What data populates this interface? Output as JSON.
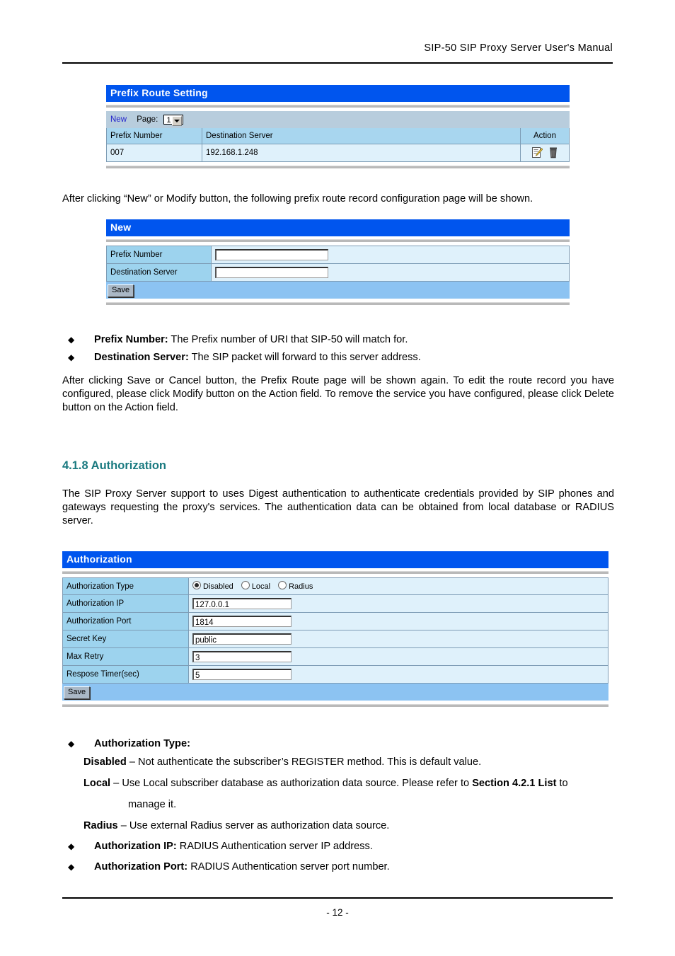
{
  "document": {
    "header_title": "SIP-50 SIP Proxy Server User's Manual",
    "footer_page": "- 12 -"
  },
  "prefix_route_panel": {
    "title": "Prefix Route Setting",
    "toolbar": {
      "new_link": "New",
      "page_label": "Page:",
      "page_value": "1"
    },
    "columns": [
      "Prefix Number",
      "Destination Server",
      "Action"
    ],
    "rows": [
      {
        "prefix_number": "007",
        "destination_server": "192.168.1.248",
        "actions": [
          "modify-icon",
          "delete-icon"
        ]
      }
    ]
  },
  "paragraph_after_prefix": "After clicking “New” or Modify button, the following prefix route record configuration page will be shown.",
  "new_panel": {
    "title": "New",
    "fields": [
      {
        "label": "Prefix Number",
        "value": "",
        "placeholder": ""
      },
      {
        "label": "Destination Server",
        "value": "",
        "placeholder": ""
      }
    ],
    "save_label": "Save"
  },
  "prefix_bullets": [
    {
      "term": "Prefix Number:",
      "desc": " The Prefix number of URI that SIP-50 will match for."
    },
    {
      "term": "Destination Server:",
      "desc": " The SIP packet will forward to this server address."
    }
  ],
  "paragraph_after_new": "After clicking Save or Cancel button, the Prefix Route page will be shown again.    To edit the route record you have configured, please click Modify button on the Action field.    To remove the service you have configured, please click Delete button on the Action field.",
  "section": {
    "heading": "4.1.8 Authorization",
    "intro": "The SIP Proxy Server support to uses Digest authentication to authenticate credentials provided by SIP phones and gateways requesting the proxy's services. The authentication data can be obtained from local database or RADIUS server."
  },
  "authorization_panel": {
    "title": "Authorization",
    "type_row": {
      "label": "Authorization Type",
      "options": [
        {
          "label": "Disabled",
          "selected": true
        },
        {
          "label": "Local",
          "selected": false
        },
        {
          "label": "Radius",
          "selected": false
        }
      ]
    },
    "fields": [
      {
        "label": "Authorization IP",
        "value": "127.0.0.1"
      },
      {
        "label": "Authorization Port",
        "value": "1814"
      },
      {
        "label": "Secret Key",
        "value": "public"
      },
      {
        "label": "Max Retry",
        "value": "3"
      },
      {
        "label": "Respose Timer(sec)",
        "value": "5"
      }
    ],
    "save_label": "Save"
  },
  "auth_bullets": {
    "type_term": "Authorization Type:",
    "sub_items": [
      {
        "term": "Disabled",
        "desc": " – Not authenticate the subscriber’s REGISTER method. This is default value."
      },
      {
        "term": "Local",
        "desc_pre": " – Use Local subscriber database as authorization data source. Please refer to ",
        "ref": "Section 4.2.1 List",
        "desc_post": " to",
        "continuation": "manage it."
      },
      {
        "term": "Radius",
        "desc": " – Use external Radius server as authorization data source."
      }
    ],
    "ip_term": "Authorization IP:",
    "ip_desc": " RADIUS Authentication server IP address.",
    "port_term": "Authorization Port:",
    "port_desc": " RADIUS Authentication server port number."
  },
  "colors": {
    "title_bar": "#0055EE",
    "heading_teal": "#1a7a80",
    "label_cell": "#9dd3ee",
    "header_cell": "#a8d6ef",
    "data_cell": "#dff1fb",
    "toolbar": "#b8cddd",
    "save_bar": "#8cc3f2",
    "link": "#2222cc"
  }
}
